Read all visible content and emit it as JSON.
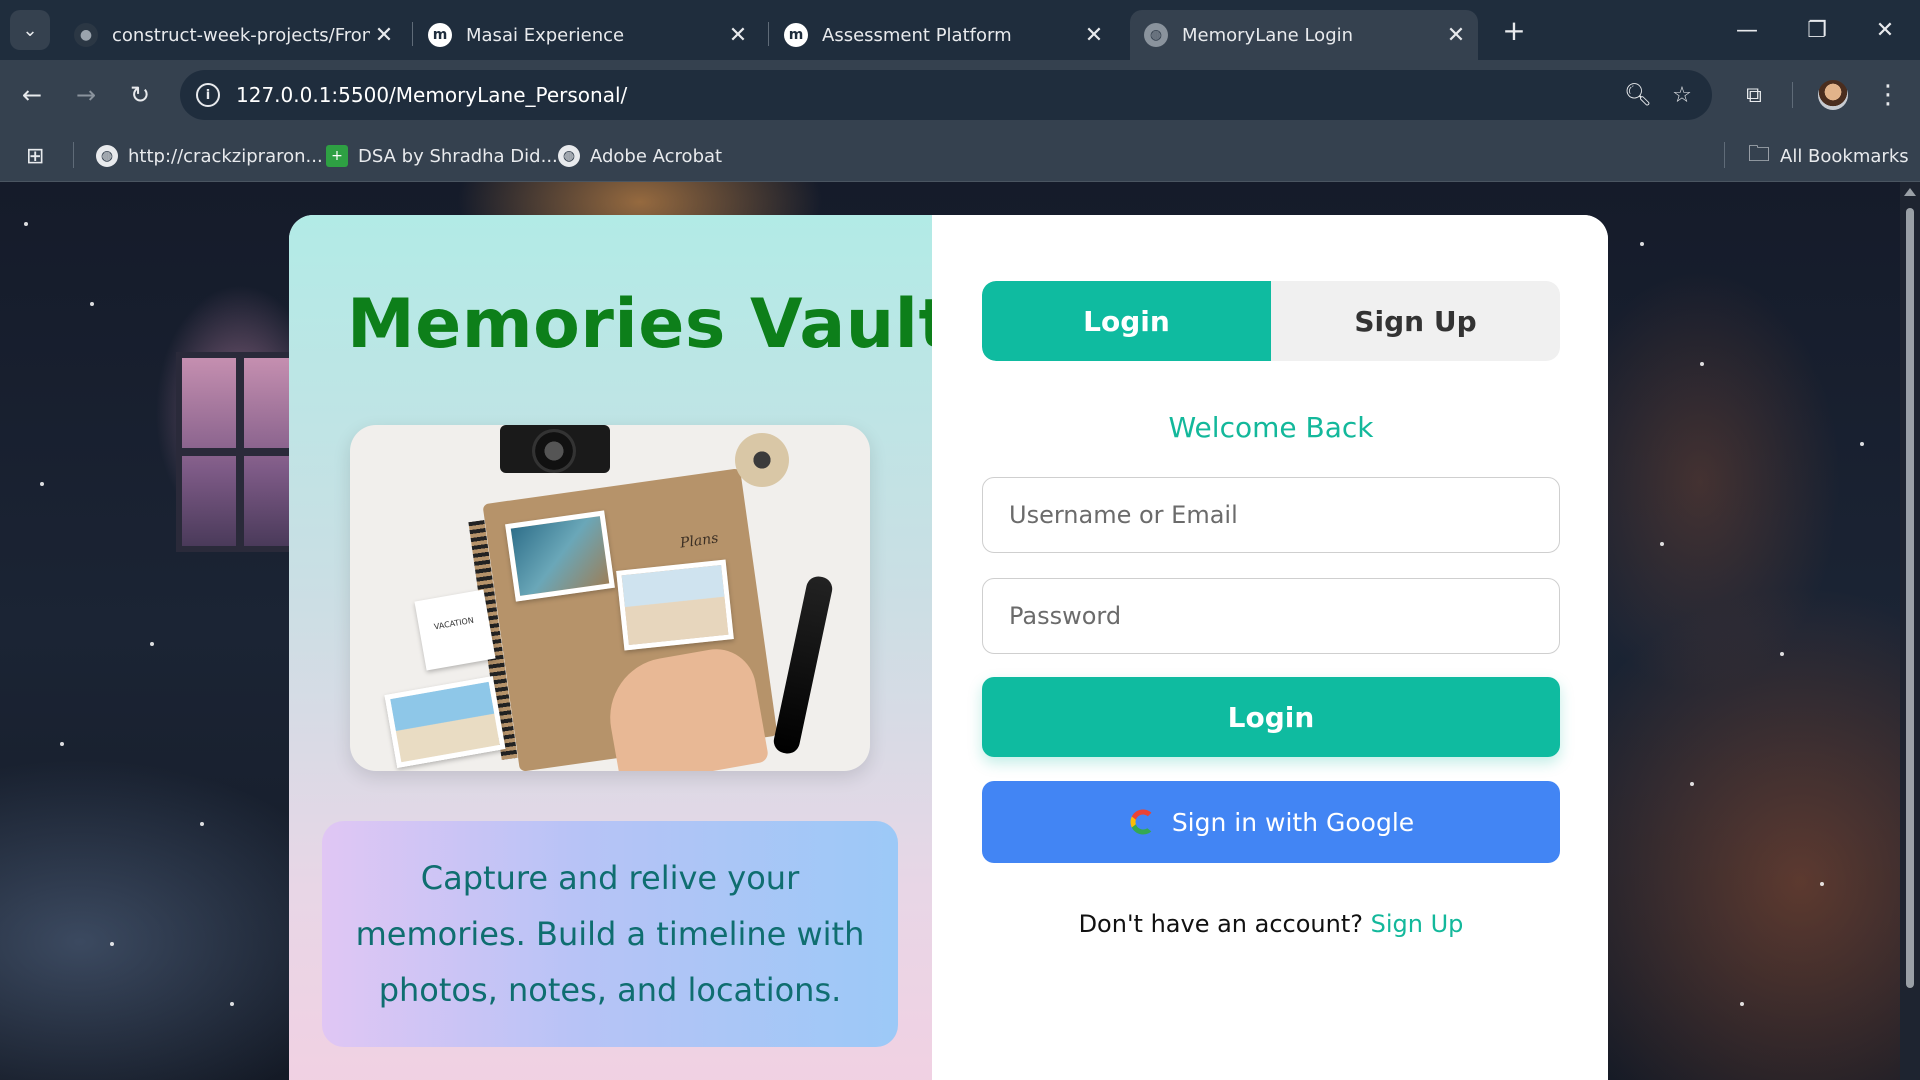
{
  "browser": {
    "tabs": [
      {
        "title": "construct-week-projects/FrontE",
        "favicon": "github-icon",
        "active": false
      },
      {
        "title": "Masai Experience",
        "favicon": "masai-icon",
        "active": false
      },
      {
        "title": "Assessment Platform",
        "favicon": "masai-icon",
        "active": false
      },
      {
        "title": "MemoryLane Login",
        "favicon": "globe-icon",
        "active": true
      }
    ],
    "tab_close_glyph": "✕",
    "new_tab_glyph": "+",
    "url": "127.0.0.1:5500/MemoryLane_Personal/",
    "bookmarks": [
      {
        "label": "http://crackzipraron...",
        "icon": "globe-icon"
      },
      {
        "label": "DSA by Shradha Did...",
        "icon": "green-plus-icon"
      },
      {
        "label": "Adobe Acrobat",
        "icon": "globe-icon"
      }
    ],
    "all_bookmarks_label": "All Bookmarks"
  },
  "page": {
    "title": "Memories Vault",
    "photo_label": "Plans",
    "photo_vacation": "VACATION",
    "tagline": "Capture and relive your memories. Build a timeline with photos, notes, and locations.",
    "tabs": {
      "login": "Login",
      "signup": "Sign Up",
      "active": "login"
    },
    "welcome": "Welcome Back",
    "username_placeholder": "Username or Email",
    "password_placeholder": "Password",
    "login_button": "Login",
    "google_button": "Sign in with Google",
    "no_account_text": "Don't have an account?",
    "signup_link": "Sign Up"
  },
  "colors": {
    "accent": "#0fbba0",
    "title_green": "#0d7f1a",
    "google_blue": "#4285f4",
    "tagline_text": "#0f6e70"
  }
}
